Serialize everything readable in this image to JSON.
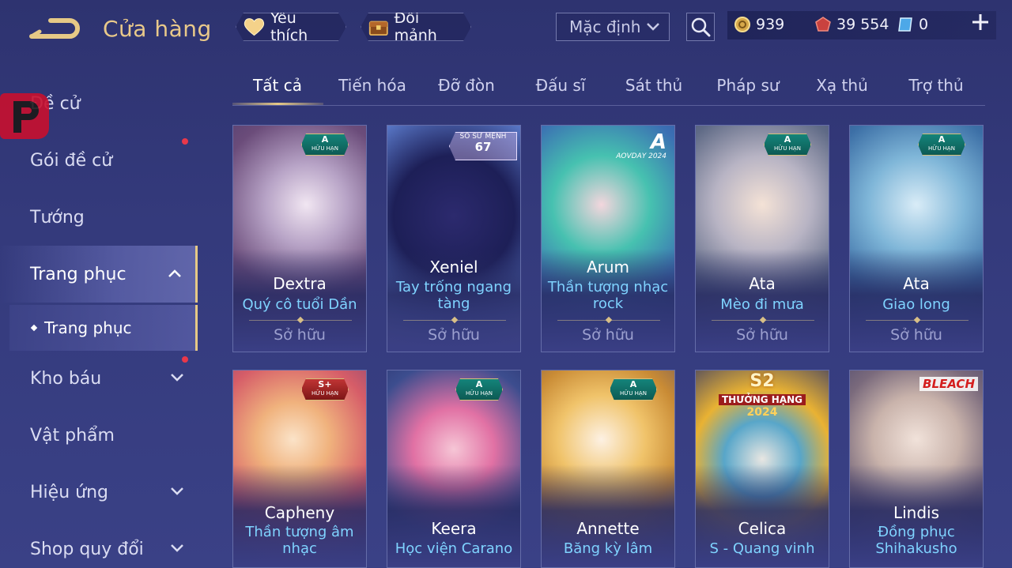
{
  "header": {
    "title": "Cửa hàng",
    "favorites_label": "Yêu thích",
    "shard_exchange_label": "Đổi mảnh",
    "sort_value": "Mặc định",
    "currencies": {
      "gold": "939",
      "rubies": "39 554",
      "tickets": "0"
    }
  },
  "sidebar": {
    "items": [
      {
        "label": "Đề cử"
      },
      {
        "label": "Gói đề cử"
      },
      {
        "label": "Tướng"
      },
      {
        "label": "Trang phục"
      },
      {
        "label": "Kho báu"
      },
      {
        "label": "Vật phẩm"
      },
      {
        "label": "Hiệu ứng"
      },
      {
        "label": "Shop quy đổi"
      }
    ],
    "sub_item": "Trang phục"
  },
  "tabs": [
    "Tất cả",
    "Tiến hóa",
    "Đỡ đòn",
    "Đấu sĩ",
    "Sát thủ",
    "Pháp sư",
    "Xạ thủ",
    "Trợ thủ"
  ],
  "badge_text": {
    "tier_a": "A",
    "tier_splus": "S+",
    "limited": "HỮU HẠN"
  },
  "labels": {
    "event_title": "SỔ SỨ MỆNH",
    "event_number": "67",
    "aov_letter": "A",
    "aov_day": "AOVDAY 2024",
    "season_s": "S2",
    "season_rank": "THƯỞNG HẠNG",
    "season_year": "2024",
    "bleach": "BLEACH"
  },
  "cards": [
    {
      "hero": "Dextra",
      "skin": "Quý cô tuổi Dần",
      "status": "Sở hữu"
    },
    {
      "hero": "Xeniel",
      "skin": "Tay trống ngang tàng",
      "status": "Sở hữu"
    },
    {
      "hero": "Arum",
      "skin": "Thần tượng nhạc rock",
      "status": "Sở hữu"
    },
    {
      "hero": "Ata",
      "skin": "Mèo đi mưa",
      "status": "Sở hữu"
    },
    {
      "hero": "Ata",
      "skin": "Giao long",
      "status": "Sở hữu"
    },
    {
      "hero": "Capheny",
      "skin": "Thần tượng âm nhạc"
    },
    {
      "hero": "Keera",
      "skin": "Học viện Carano"
    },
    {
      "hero": "Annette",
      "skin": "Băng kỳ lâm"
    },
    {
      "hero": "Celica",
      "skin": "S - Quang vinh"
    },
    {
      "hero": "Lindis",
      "skin": "Đồng phục Shihakusho"
    }
  ],
  "colors": {
    "accent_gold": "#e6c986",
    "skin_name_blue": "#7fd3ff",
    "notification_red": "#e9384a"
  }
}
